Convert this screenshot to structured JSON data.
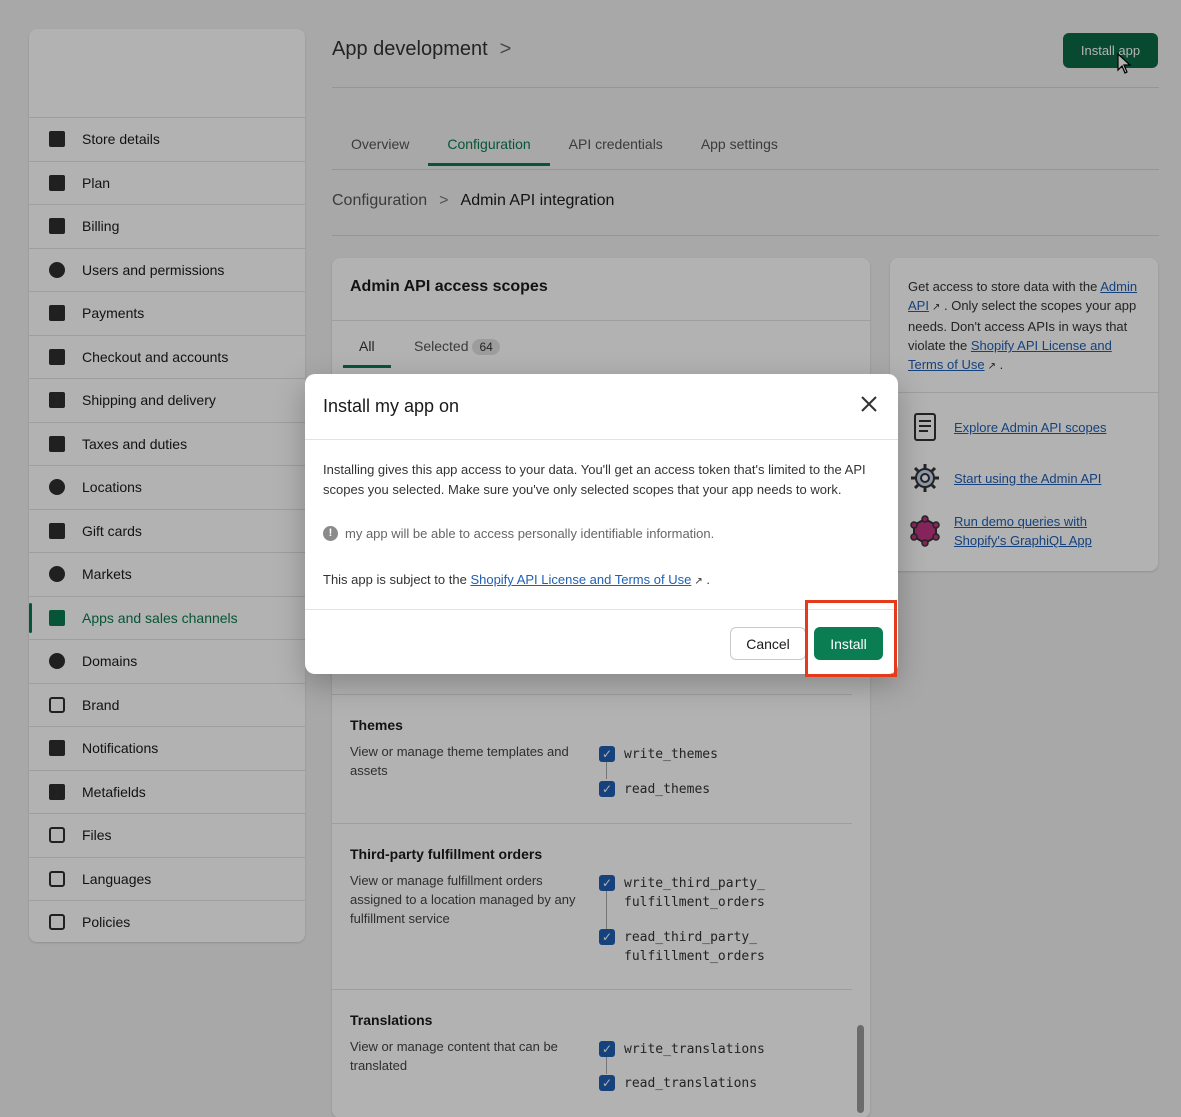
{
  "header": {
    "title": "App development",
    "title_chevron": ">",
    "install_app_label": "Install app"
  },
  "sidebar": {
    "items": [
      {
        "label": "Store details",
        "icon": "store-icon"
      },
      {
        "label": "Plan",
        "icon": "plan-icon"
      },
      {
        "label": "Billing",
        "icon": "billing-icon"
      },
      {
        "label": "Users and permissions",
        "icon": "user-icon"
      },
      {
        "label": "Payments",
        "icon": "payments-icon"
      },
      {
        "label": "Checkout and accounts",
        "icon": "cart-icon"
      },
      {
        "label": "Shipping and delivery",
        "icon": "truck-icon"
      },
      {
        "label": "Taxes and duties",
        "icon": "tax-icon"
      },
      {
        "label": "Locations",
        "icon": "location-pin-icon"
      },
      {
        "label": "Gift cards",
        "icon": "gift-icon"
      },
      {
        "label": "Markets",
        "icon": "globe-icon"
      },
      {
        "label": "Apps and sales channels",
        "icon": "apps-icon",
        "active": true
      },
      {
        "label": "Domains",
        "icon": "domains-globe-icon"
      },
      {
        "label": "Brand",
        "icon": "brand-icon"
      },
      {
        "label": "Notifications",
        "icon": "bell-icon"
      },
      {
        "label": "Metafields",
        "icon": "metafields-icon"
      },
      {
        "label": "Files",
        "icon": "paperclip-icon"
      },
      {
        "label": "Languages",
        "icon": "translate-icon"
      },
      {
        "label": "Policies",
        "icon": "policy-icon"
      }
    ]
  },
  "tabs": [
    "Overview",
    "Configuration",
    "API credentials",
    "App settings"
  ],
  "active_tab": "Configuration",
  "breadcrumb": {
    "parent": "Configuration",
    "separator": ">",
    "current": "Admin API integration"
  },
  "scopes_card": {
    "title": "Admin API access scopes",
    "tab_all": "All",
    "tab_selected": "Selected",
    "selected_count": "64",
    "sections": [
      {
        "title": "Themes",
        "description": "View or manage theme templates and assets",
        "scopes": [
          "write_themes",
          "read_themes"
        ]
      },
      {
        "title": "Third-party fulfillment orders",
        "description": "View or manage fulfillment orders assigned to a location managed by any fulfillment service",
        "scopes": [
          "write_third_party_\nfulfillment_orders",
          "read_third_party_\nfulfillment_orders"
        ]
      },
      {
        "title": "Translations",
        "description": "View or manage content that can be translated",
        "scopes": [
          "write_translations",
          "read_translations"
        ]
      }
    ]
  },
  "side_card": {
    "intro_1": "Get access to store data with the",
    "admin_api_link": "Admin API",
    "intro_2": ". Only select the scopes your app needs. Don't access APIs in ways that violate the",
    "terms_link": "Shopify API License and Terms of Use",
    "intro_3": ".",
    "resources": [
      {
        "label": "Explore Admin API scopes",
        "icon": "scroll-icon"
      },
      {
        "label": "Start using the Admin API",
        "icon": "gear-icon"
      },
      {
        "label": "Run demo queries with Shopify's GraphiQL App",
        "icon": "graphql-icon"
      }
    ]
  },
  "modal": {
    "title": "Install my app on",
    "body": "Installing gives this app access to your data. You'll get an access token that's limited to the API scopes you selected. Make sure you've only selected scopes that your app needs to work.",
    "note": "my app will be able to access personally identifiable information.",
    "terms_prefix": "This app is subject to the",
    "terms_link": "Shopify API License and Terms of Use",
    "terms_suffix": ".",
    "cancel_label": "Cancel",
    "install_label": "Install"
  },
  "colors": {
    "primary_green": "#0b7d52",
    "link_blue": "#1f5fb4",
    "highlight_red": "#e53a1c"
  }
}
